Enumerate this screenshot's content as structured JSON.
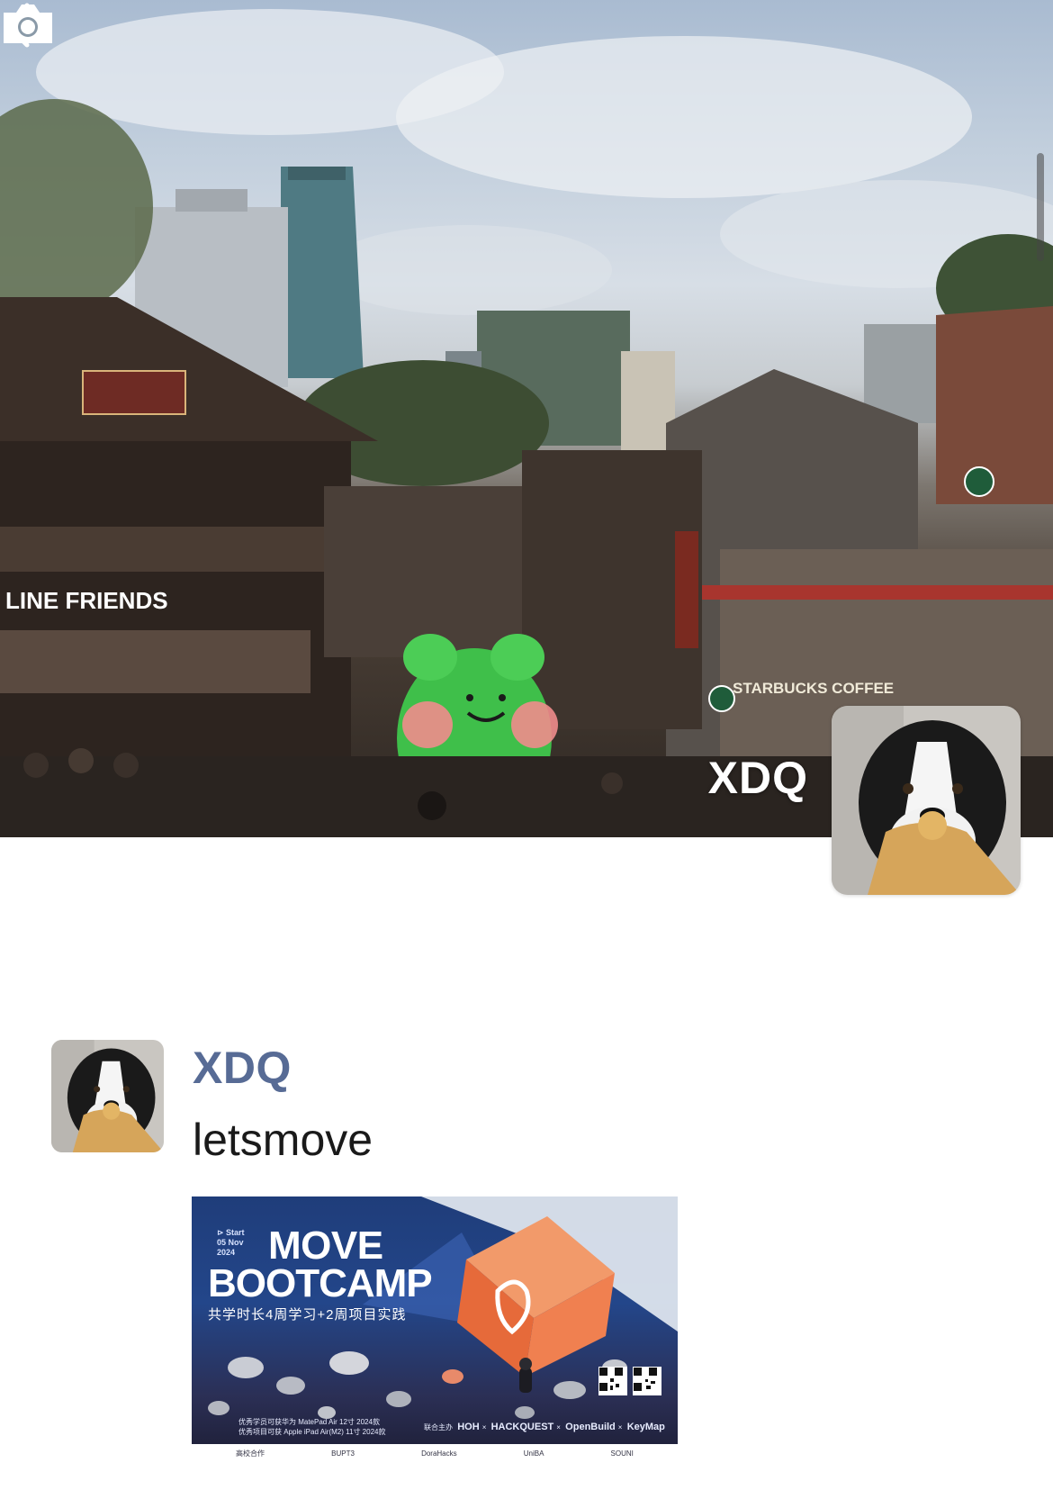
{
  "header": {
    "back_icon": "chevron-left-icon",
    "camera_icon": "camera-icon"
  },
  "profile": {
    "name": "XDQ",
    "avatar": "border-collie-dog-photo"
  },
  "post": {
    "author": "XDQ",
    "text": "letsmove",
    "avatar": "border-collie-dog-photo",
    "image": {
      "start_label": "⊳ Start",
      "date_line_1": "05 Nov",
      "date_line_2": "2024",
      "title_line_1": "MOVE",
      "title_line_2": "BOOTCAMP",
      "subtitle": "共学时长4周学习+2周项目实践",
      "footnote_1": "优秀学员可获华为 MatePad Air 12寸 2024款",
      "footnote_2": "优秀项目可获 Apple iPad Air(M2) 11寸 2024款",
      "sponsor_label": "联合主办",
      "sponsors": [
        "HOH",
        "HACKQUEST",
        "OpenBuild",
        "KeyMap"
      ],
      "partners": [
        "高校合作",
        "BUPT3",
        "DoraHacks",
        "UniBA",
        "SOUNI"
      ]
    }
  },
  "colors": {
    "author_link": "#576b95",
    "text": "#1a1a1a",
    "background": "#ffffff"
  }
}
